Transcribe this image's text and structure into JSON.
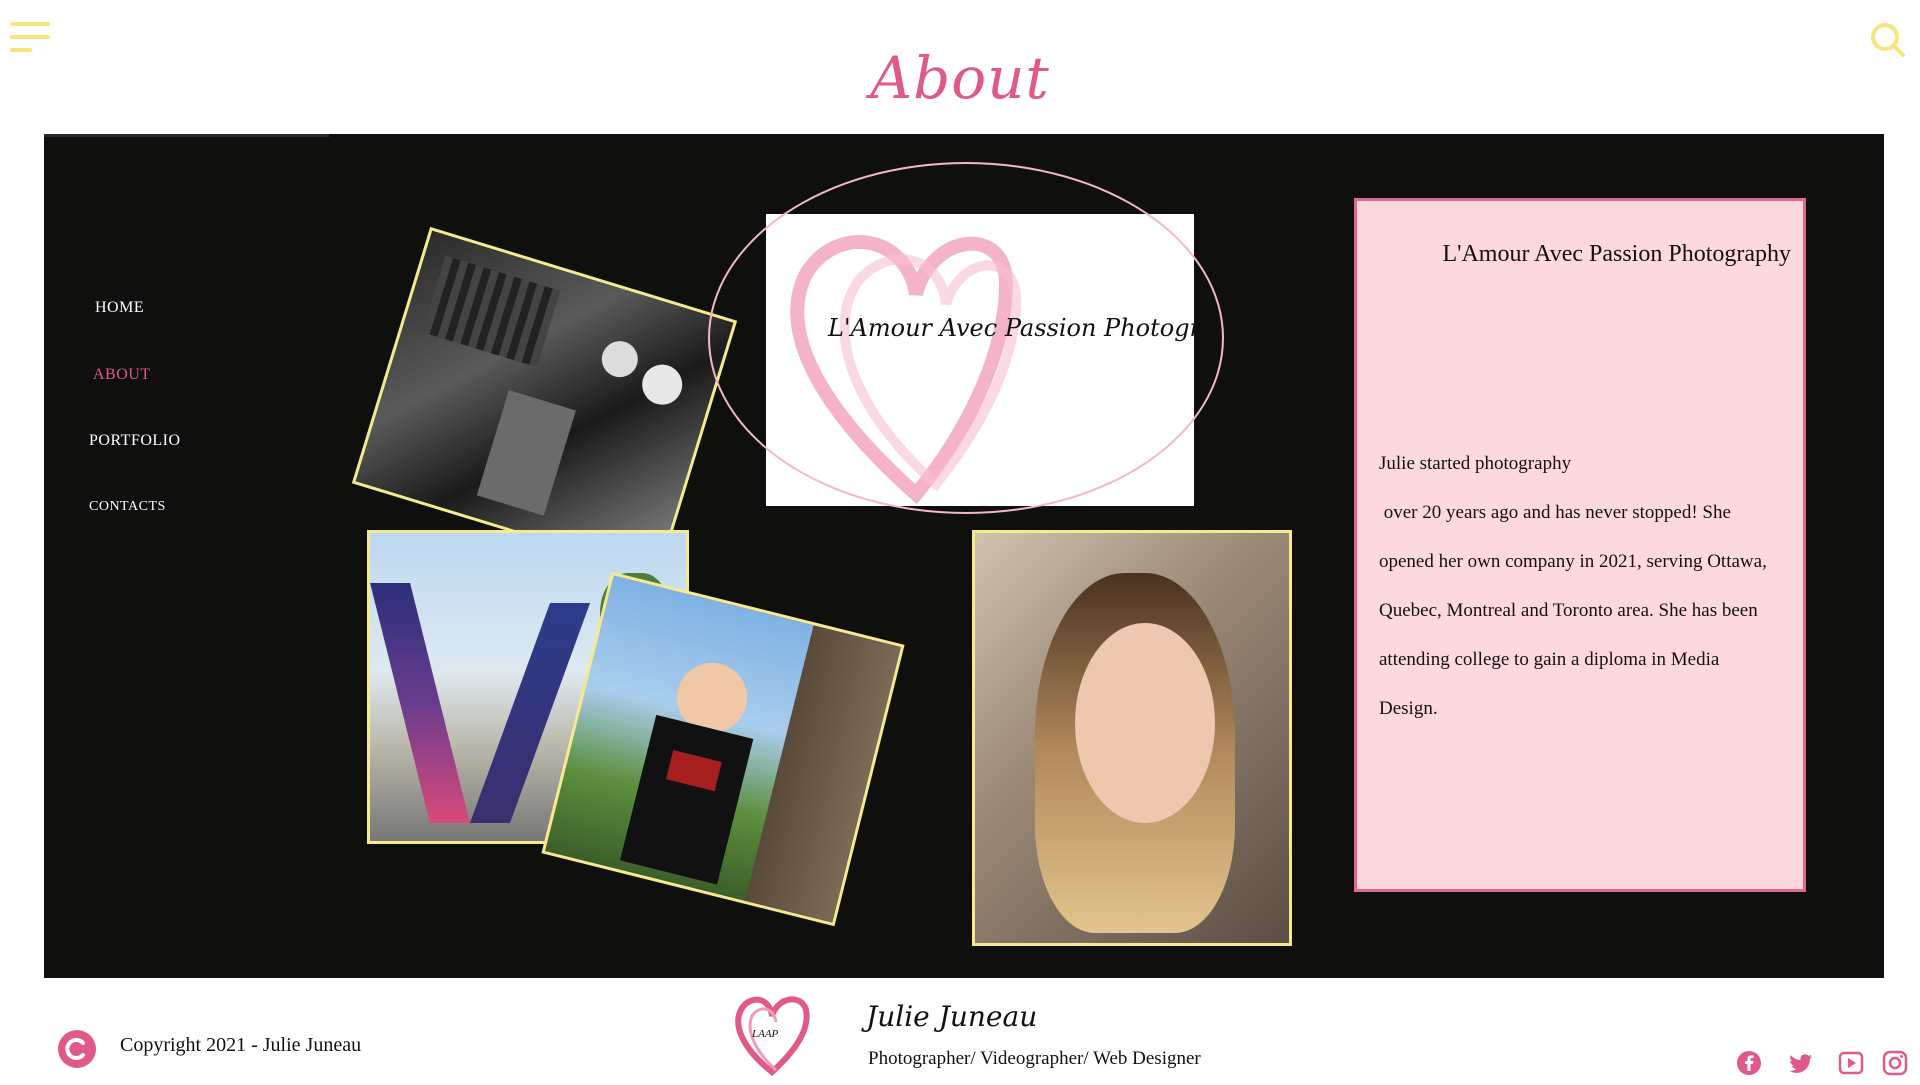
{
  "header": {
    "menu_icon": "hamburger-icon",
    "search_icon": "search-icon",
    "title": "About"
  },
  "nav": {
    "items": [
      {
        "label": "HOME",
        "active": false
      },
      {
        "label": "ABOUT",
        "active": true
      },
      {
        "label": "PORTFOLIO",
        "active": false
      },
      {
        "label": "CONTACTS",
        "active": false
      }
    ]
  },
  "logo": {
    "text": "L'Amour Avec Passion Photography"
  },
  "info": {
    "title": "L'Amour Avec Passion Photography",
    "lines": [
      "Julie started photography",
      " over 20 years ago and has never stopped! She",
      "opened her own company in 2021, serving Ottawa,",
      "Quebec, Montreal and Toronto area. She has been",
      "attending college to gain a diploma in Media",
      "Design."
    ]
  },
  "footer": {
    "copyright": "Copyright 2021 - Julie Juneau",
    "name": "Julie Juneau",
    "role": "Photographer/ Videographer/ Web Designer",
    "logo_text": "LAAP",
    "social": [
      "facebook-icon",
      "twitter-icon",
      "youtube-icon",
      "instagram-icon"
    ]
  },
  "colors": {
    "accent_pink": "#e0598a",
    "accent_yellow": "#f7e98e",
    "panel_bg": "#0f0f0d",
    "card_bg": "#fdd9dd"
  }
}
